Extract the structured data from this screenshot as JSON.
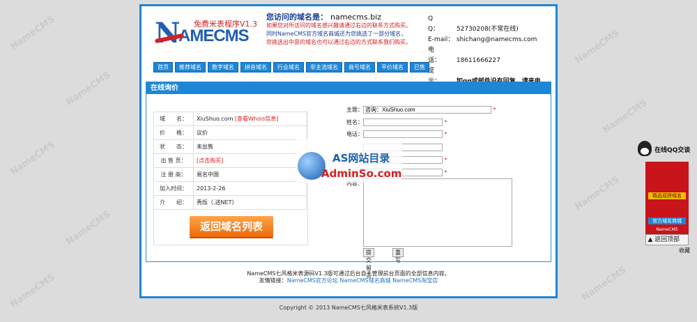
{
  "watermark": "NameCMS",
  "logo": {
    "big": "N",
    "name": "AMECMS",
    "subtitle": "免费米表程序V1.3"
  },
  "intro": {
    "label": "您访问的域名是：",
    "domain": "namecms.biz",
    "line1": "如果您对所访问的域名感兴趣请通过右边的联系方式购买。",
    "line2": "同时NameCMS官方域名商城还为您挑选了一部分域名，",
    "line3": "您挑选出中意的域名也可以通过右边的方式联系我们购买。"
  },
  "contact": [
    {
      "k": "Q　　Q：",
      "v": "52730208(不常在线)"
    },
    {
      "k": "E-mail：",
      "v": "shichang@namecms.com"
    },
    {
      "k": "电　　话：",
      "v": "18611666227"
    },
    {
      "k": "提　　示：",
      "v": "如qq或邮件没有回复，请来电。"
    }
  ],
  "nav": [
    "首页",
    "推荐域名",
    "数字域名",
    "拼音域名",
    "行业域名",
    "非主流域名",
    "商号域名",
    "平价域名",
    "已售"
  ],
  "panel_title": "在线询价",
  "info": [
    {
      "k": "域　　名：",
      "v": "XiuShuo.com",
      "link": "[查看Whois信息]"
    },
    {
      "k": "价　　格：",
      "v": "议价"
    },
    {
      "k": "状　　态：",
      "v": "未出售"
    },
    {
      "k": "出 售 页：",
      "v": "",
      "link": "[点击购买]"
    },
    {
      "k": "注 册 商：",
      "v": "易名中国"
    },
    {
      "k": "加入时间：",
      "v": "2013-2-26"
    },
    {
      "k": "介　　绍：",
      "v": "秀烁（.送NET）"
    }
  ],
  "back_button": "返回域名列表",
  "form": {
    "subject_label": "主题：",
    "subject_value": "咨询：XiuShuo.com",
    "name_label": "姓名：",
    "phone_label": "电话：",
    "content_label": "内容：",
    "submit": "提交留言",
    "reset": "重写"
  },
  "footer": {
    "line1": "NameCMS七风格米表源码V1.3版可通过后台自主管理前台页面的全部信息内容。",
    "links_label": "友情链接：",
    "links": [
      "NameCMS官方论坛",
      "NameCMS域名商城",
      "NameCMS淘宝店"
    ]
  },
  "copyright": "Copyright © 2013 NameCMS七风格米表系统V1.3版",
  "adminso": {
    "t1": "AS网站目录",
    "t2": "AdminSo.com"
  },
  "qq_widget": "在线QQ交谈",
  "ad": {
    "b1": "精品双拼域名",
    "b2": "官方域名商城",
    "b3": "NameCMS"
  },
  "back_top": "返回顶部",
  "favorite": "收藏"
}
